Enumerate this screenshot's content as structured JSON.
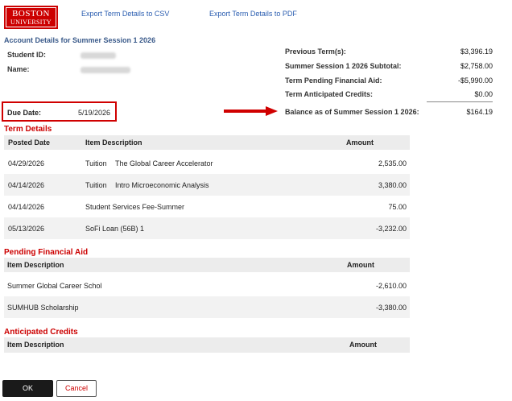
{
  "logo": {
    "line1": "BOSTON",
    "line2": "UNIVERSITY"
  },
  "links": {
    "export_csv": "Export Term Details to CSV",
    "export_pdf": "Export Term Details to PDF"
  },
  "account": {
    "title": "Account Details for Summer Session 1 2026",
    "student_id_label": "Student ID:",
    "name_label": "Name:"
  },
  "summary": {
    "previous_label": "Previous Term(s):",
    "previous_value": "$3,396.19",
    "subtotal_label": "Summer Session 1 2026 Subtotal:",
    "subtotal_value": "$2,758.00",
    "pending_label": "Term Pending Financial Aid:",
    "pending_value": "-$5,990.00",
    "anticipated_label": "Term Anticipated Credits:",
    "anticipated_value": "$0.00",
    "balance_label": "Balance as of Summer Session 1 2026:",
    "balance_value": "$164.19"
  },
  "due": {
    "label": "Due Date:",
    "value": "5/19/2026"
  },
  "term_details": {
    "heading": "Term Details",
    "col_posted": "Posted Date",
    "col_desc": "Item Description",
    "col_amount": "Amount",
    "rows": [
      {
        "date": "04/29/2026",
        "type": "Tuition",
        "desc": "The Global Career Accelerator",
        "amount": "2,535.00"
      },
      {
        "date": "04/14/2026",
        "type": "Tuition",
        "desc": "Intro Microeconomic Analysis",
        "amount": "3,380.00"
      },
      {
        "date": "04/14/2026",
        "type": "Student Services Fee-Summer",
        "desc": "",
        "amount": "75.00"
      },
      {
        "date": "05/13/2026",
        "type": "SoFi Loan (56B) 1",
        "desc": "",
        "amount": "-3,232.00"
      }
    ]
  },
  "pending_aid": {
    "heading": "Pending Financial Aid",
    "col_desc": "Item Description",
    "col_amount": "Amount",
    "rows": [
      {
        "desc": "Summer Global Career Schol",
        "amount": "-2,610.00"
      },
      {
        "desc": "SUMHUB Scholarship",
        "amount": "-3,380.00"
      }
    ]
  },
  "anticipated_credits": {
    "heading": "Anticipated Credits",
    "col_desc": "Item Description",
    "col_amount": "Amount"
  },
  "buttons": {
    "ok": "OK",
    "cancel": "Cancel"
  }
}
